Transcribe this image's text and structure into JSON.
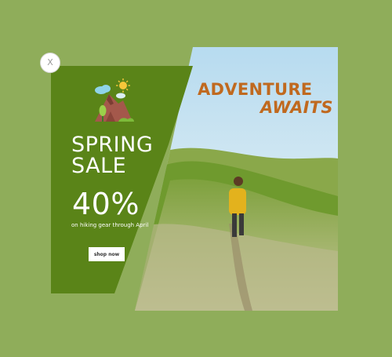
{
  "popup": {
    "close_label": "X",
    "title_line1": "SPRING",
    "title_line2": "SALE",
    "discount": "40%",
    "subtext": "on hiking gear through April",
    "cta_label": "shop now",
    "headline_line1": "ADVENTURE",
    "headline_line2": "AWAITS"
  },
  "colors": {
    "page_background": "#8fad5a",
    "panel_green": "#5a8418",
    "headline_orange": "#c0691f",
    "button_white": "#ffffff"
  },
  "icons": {
    "logo": "mountain-sun-clouds-icon"
  }
}
